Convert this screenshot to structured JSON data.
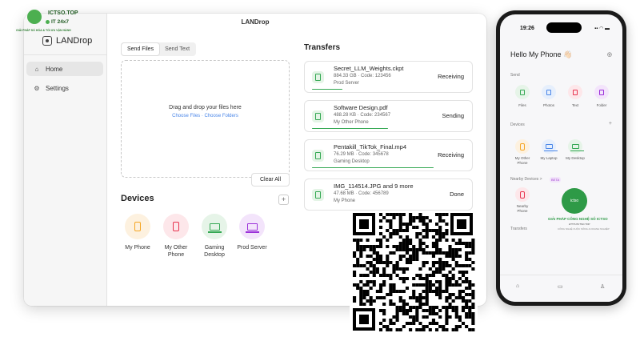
{
  "badge": {
    "name": "ICTSO.TOP",
    "line": "IT 24x7",
    "sub": "GIẢI PHÁP SỐ HÓA & TỐI ƯU VẬN HÀNH"
  },
  "window": {
    "title": "LANDrop",
    "app_name": "LANDrop",
    "nav": [
      {
        "label": "Home",
        "icon": "home-icon",
        "active": true
      },
      {
        "label": "Settings",
        "icon": "gear-icon",
        "active": false
      }
    ]
  },
  "send": {
    "tabs": [
      "Send Files",
      "Send Text"
    ],
    "active_tab": "Send Files",
    "drop_text": "Drag and drop your files here",
    "choose_files": "Choose Files",
    "link_separator": "·",
    "choose_folders": "Choose Folders",
    "clear_all": "Clear All"
  },
  "devices": {
    "title": "Devices",
    "add_label": "+",
    "items": [
      {
        "name": "My Phone",
        "icon": "phone-icon",
        "color": "#f5a623",
        "bg": "#fdf1df"
      },
      {
        "name": "My Other Phone",
        "icon": "phone-icon",
        "color": "#e8334f",
        "bg": "#fde7ea"
      },
      {
        "name": "Gaming Desktop",
        "icon": "laptop-icon",
        "color": "#34a853",
        "bg": "#e6f4e8"
      },
      {
        "name": "Prod Server",
        "icon": "laptop-icon",
        "color": "#9b30d9",
        "bg": "#f3e4fb"
      }
    ]
  },
  "transfers": {
    "title": "Transfers",
    "items": [
      {
        "name": "Secret_LLM_Weights.ckpt",
        "sub": "884.33 GB · Code: 123456",
        "device": "Prod Server",
        "status": "Receiving",
        "progress": 0.2
      },
      {
        "name": "Software Design.pdf",
        "sub": "488.28 KB · Code: 234567",
        "device": "My Other Phone",
        "status": "Sending",
        "progress": 0.5
      },
      {
        "name": "Pentakill_TikTok_Final.mp4",
        "sub": "76.29 MB · Code: 345678",
        "device": "Gaming Desktop",
        "status": "Receiving",
        "progress": 0.8
      },
      {
        "name": "IMG_114514.JPG and 9 more",
        "sub": "47.68 MB · Code: 456789",
        "device": "My Phone",
        "status": "Done",
        "progress": 1.0
      }
    ]
  },
  "phone": {
    "time": "19:26",
    "hello": "Hello My Phone 👋🏻",
    "send_label": "Send",
    "actions": [
      {
        "label": "Files",
        "color": "#34a853",
        "bg": "#e6f4e8"
      },
      {
        "label": "Photos",
        "color": "#4a86e8",
        "bg": "#e6effc"
      },
      {
        "label": "Text",
        "color": "#e8334f",
        "bg": "#fde7ea"
      },
      {
        "label": "Folder",
        "color": "#9b30d9",
        "bg": "#f3e4fb"
      }
    ],
    "devices_label": "Devices",
    "add_label": "+",
    "devices": [
      {
        "label": "My Other Phone",
        "color": "#f5a623",
        "bg": "#fdf1df"
      },
      {
        "label": "My Laptop",
        "color": "#4a86e8",
        "bg": "#e6effc"
      },
      {
        "label": "My Desktop",
        "color": "#34a853",
        "bg": "#e6f4e8"
      }
    ],
    "nearby_label": "Nearby Devices >",
    "beta": "BETA",
    "nearby_device": "Nearby Phone",
    "watermark_circle": "ictso",
    "watermark_title": "GIẢI PHÁP CÔNG NGHỆ SỐ ICTSO",
    "watermark_sub1": "HTTP://ICTSO.TOP",
    "watermark_sub2": "CÔNG NGHỆ CUỘC SỐNG & DOANH NGHIỆP",
    "transfers_label": "Transfers",
    "tab_home": "⌂",
    "tab_folder": "▭",
    "tab_person": "♙"
  }
}
